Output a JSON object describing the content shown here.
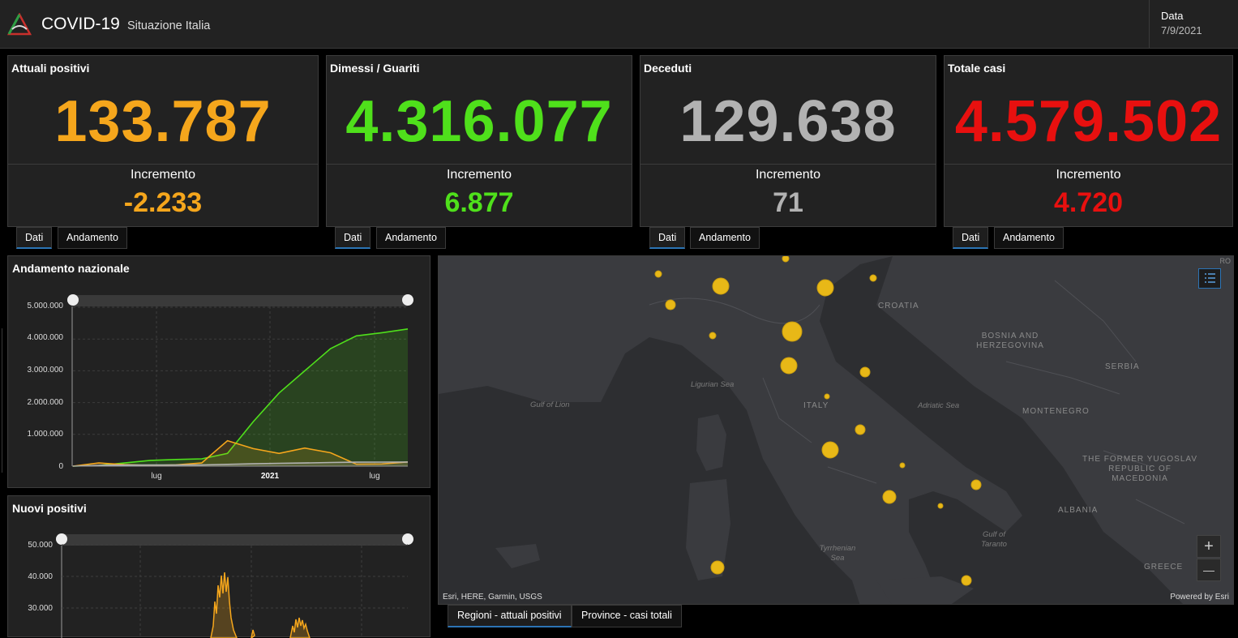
{
  "header": {
    "title": "COVID-19",
    "subtitle": "Situazione Italia",
    "date_label": "Data",
    "date_value": "7/9/2021"
  },
  "cards": [
    {
      "title": "Attuali positivi",
      "value": "133.787",
      "inc_label": "Incremento",
      "inc": "-2.233",
      "color": "#f5a61c"
    },
    {
      "title": "Dimessi / Guariti",
      "value": "4.316.077",
      "inc_label": "Incremento",
      "inc": "6.877",
      "color": "#4fe01b"
    },
    {
      "title": "Deceduti",
      "value": "129.638",
      "inc_label": "Incremento",
      "inc": "71",
      "color": "#b2b2b2"
    },
    {
      "title": "Totale casi",
      "value": "4.579.502",
      "inc_label": "Incremento",
      "inc": "4.720",
      "color": "#e8100f"
    }
  ],
  "card_tabs": {
    "dati": "Dati",
    "andamento": "Andamento"
  },
  "panels": {
    "andamento_title": "Andamento nazionale",
    "nuovi_title": "Nuovi positivi"
  },
  "chart_data": [
    {
      "type": "area",
      "title": "Andamento nazionale",
      "y_ticks": [
        "5.000.000",
        "4.000.000",
        "3.000.000",
        "2.000.000",
        "1.000.000",
        "0"
      ],
      "x_ticks": [
        "lug",
        "2021",
        "lug"
      ],
      "ylim": [
        0,
        5000000
      ],
      "grid": true,
      "series": [
        {
          "color": "#4fe01b",
          "values": [
            0,
            20000,
            100000,
            180000,
            210000,
            230000,
            400000,
            1400000,
            2300000,
            3000000,
            3700000,
            4100000,
            4200000,
            4316077
          ]
        },
        {
          "color": "#f5a61c",
          "values": [
            0,
            100000,
            50000,
            20000,
            40000,
            100000,
            800000,
            550000,
            400000,
            570000,
            420000,
            60000,
            70000,
            133787
          ]
        },
        {
          "color": "#b2b2b2",
          "values": [
            0,
            25000,
            33000,
            35000,
            36000,
            38000,
            55000,
            75000,
            90000,
            100000,
            115000,
            125000,
            128000,
            129638
          ]
        }
      ]
    },
    {
      "type": "area",
      "title": "Nuovi positivi",
      "y_ticks": [
        "50.000",
        "40.000",
        "30.000"
      ],
      "ylim": [
        20000,
        50000
      ],
      "grid": true,
      "series": [
        {
          "color": "#f5a61c",
          "values": []
        }
      ]
    }
  ],
  "map": {
    "labels": [
      "CROATIA",
      "BOSNIA AND HERZEGOVINA",
      "SERBIA",
      "MONTENEGRO",
      "ITALY",
      "THE FORMER YUGOSLAV REPUBLIC OF MACEDONIA",
      "ALBANIA",
      "GREECE",
      "RO"
    ],
    "seas": [
      "Gulf of Lion",
      "Ligurian Sea",
      "Adriatic Sea",
      "Tyrrhenian Sea",
      "Gulf of Taranto"
    ],
    "attribution": "Esri, HERE, Garmin, USGS",
    "powered": "Powered by Esri",
    "zoom_in": "+",
    "zoom_out": "—",
    "bubble_color": "#e8b817"
  },
  "map_tabs": [
    "Regioni - attuali positivi",
    "Province - casi totali"
  ]
}
